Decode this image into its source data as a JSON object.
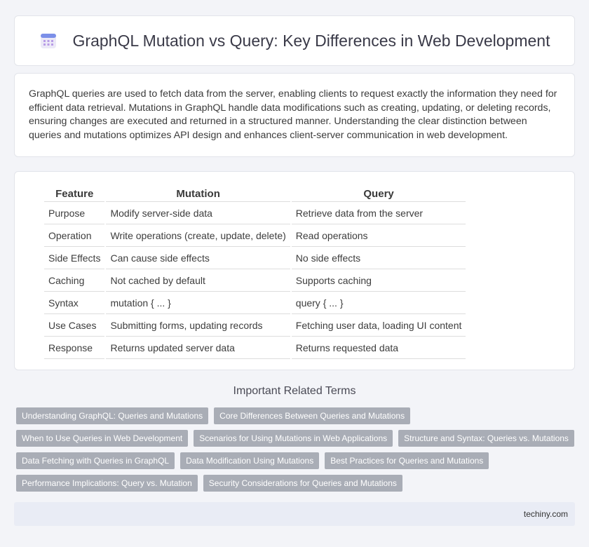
{
  "header": {
    "title": "GraphQL Mutation vs Query: Key Differences in Web Development",
    "icon": "calendar-icon"
  },
  "intro": {
    "text": "GraphQL queries are used to fetch data from the server, enabling clients to request exactly the information they need for efficient data retrieval. Mutations in GraphQL handle data modifications such as creating, updating, or deleting records, ensuring changes are executed and returned in a structured manner. Understanding the clear distinction between queries and mutations optimizes API design and enhances client-server communication in web development."
  },
  "table": {
    "headers": [
      "Feature",
      "Mutation",
      "Query"
    ],
    "rows": [
      [
        "Purpose",
        "Modify server-side data",
        "Retrieve data from the server"
      ],
      [
        "Operation",
        "Write operations (create, update, delete)",
        "Read operations"
      ],
      [
        "Side Effects",
        "Can cause side effects",
        "No side effects"
      ],
      [
        "Caching",
        "Not cached by default",
        "Supports caching"
      ],
      [
        "Syntax",
        "mutation { ... }",
        "query { ... }"
      ],
      [
        "Use Cases",
        "Submitting forms, updating records",
        "Fetching user data, loading UI content"
      ],
      [
        "Response",
        "Returns updated server data",
        "Returns requested data"
      ]
    ]
  },
  "related": {
    "title": "Important Related Terms",
    "rows": [
      [
        "Understanding GraphQL: Queries and Mutations",
        "Core Differences Between Queries and Mutations"
      ],
      [
        "When to Use Queries in Web Development",
        "Scenarios for Using Mutations in Web Applications",
        "Structure and Syntax: Queries vs. Mutations"
      ],
      [
        "Data Fetching with Queries in GraphQL",
        "Data Modification Using Mutations",
        "Best Practices for Queries and Mutations"
      ],
      [
        "Performance Implications: Query vs. Mutation",
        "Security Considerations for Queries and Mutations"
      ]
    ]
  },
  "footer": {
    "brand": "techiny.com"
  }
}
